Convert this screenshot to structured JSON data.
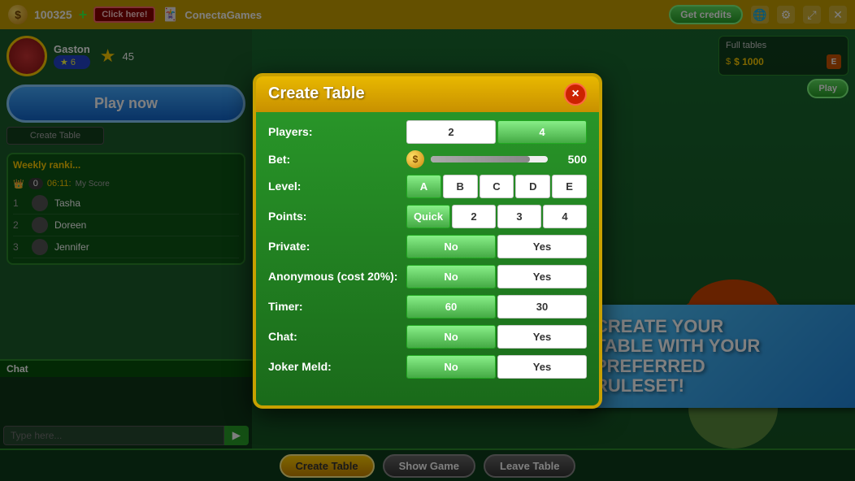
{
  "topbar": {
    "score": "100325",
    "plus_label": "+",
    "click_here": "Click here!",
    "logo": "ConectaGames",
    "get_credits": "Get credits"
  },
  "player": {
    "name": "Gaston",
    "level": "6",
    "score": "45"
  },
  "sidebar": {
    "play_now": "Play now",
    "create_table": "Create Table",
    "weekly_ranking": "Weekly ranki...",
    "my_score": "My Score",
    "timer": "06:11:",
    "chat_title": "Chat"
  },
  "ranking": [
    {
      "rank": "1",
      "name": "Tasha"
    },
    {
      "rank": "2",
      "name": "Doreen"
    },
    {
      "rank": "3",
      "name": "Jennifer"
    }
  ],
  "full_tables": {
    "title": "Full tables",
    "price": "$ 1000",
    "badge": "E",
    "play": "Play"
  },
  "modal": {
    "title": "Create Table",
    "close": "×",
    "rows": [
      {
        "label": "Players:",
        "options": [
          "2",
          "4"
        ],
        "selected": 1
      },
      {
        "label": "Level:",
        "options": [
          "A",
          "B",
          "C",
          "D",
          "E"
        ],
        "selected": 0
      },
      {
        "label": "Points:",
        "options": [
          "Quick",
          "2",
          "3",
          "4"
        ],
        "selected": 0
      },
      {
        "label": "Private:",
        "options": [
          "No",
          "Yes"
        ],
        "selected": 0
      },
      {
        "label": "Anonymous (cost 20%):",
        "options": [
          "No",
          "Yes"
        ],
        "selected": 0
      },
      {
        "label": "Timer:",
        "options": [
          "60",
          "30"
        ],
        "selected": 0
      },
      {
        "label": "Chat:",
        "options": [
          "No",
          "Yes"
        ],
        "selected": 0
      },
      {
        "label": "Joker Meld:",
        "options": [
          "No",
          "Yes"
        ],
        "selected": 0
      }
    ],
    "bet_label": "Bet:",
    "bet_value": "500"
  },
  "promo": {
    "line1": "CREATE YOUR",
    "line2": "TABLE WITH YOUR",
    "line3": "PREFERRED",
    "line4": "RULESET!"
  },
  "bottom": {
    "create_table": "Create Table",
    "show_game": "Show Game",
    "leave_table": "Leave Table"
  }
}
